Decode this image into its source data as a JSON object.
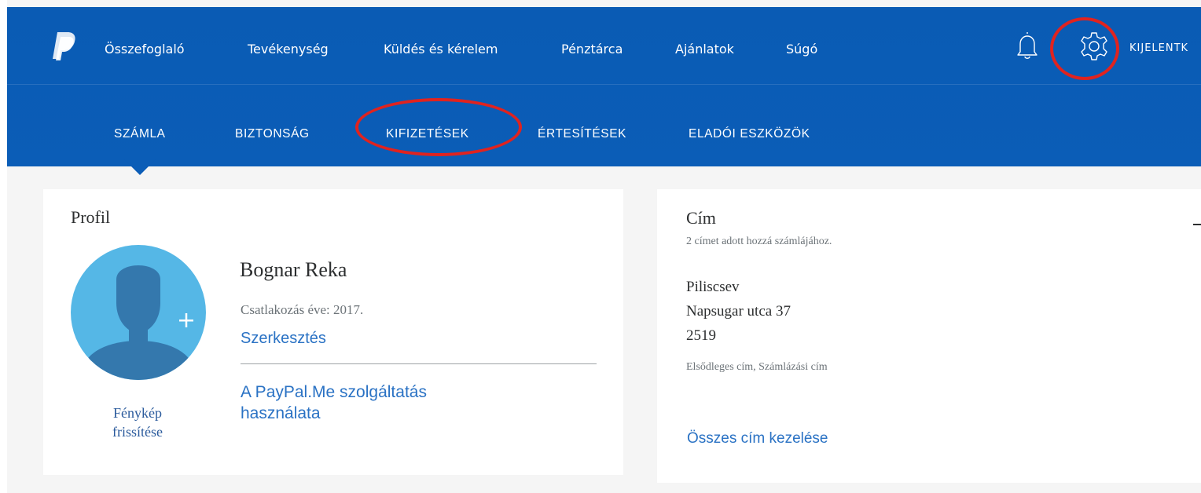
{
  "header": {
    "brand_color": "#0b5db7",
    "annotation_color": "#e0231f",
    "nav": [
      {
        "label": "Összefoglaló"
      },
      {
        "label": "Tevékenység"
      },
      {
        "label": "Küldés és kérelem"
      },
      {
        "label": "Pénztárca"
      },
      {
        "label": "Ajánlatok"
      },
      {
        "label": "Súgó"
      }
    ],
    "logout_label": "KIJELENTK",
    "subnav": [
      {
        "label": "SZÁMLA",
        "active": true
      },
      {
        "label": "BIZTONSÁG"
      },
      {
        "label": "KIFIZETÉSEK"
      },
      {
        "label": "ÉRTESÍTÉSEK"
      },
      {
        "label": "ELADÓI ESZKÖZÖK"
      }
    ],
    "icons": [
      "paypal-logo",
      "bell-icon",
      "gear-icon"
    ]
  },
  "profile": {
    "title": "Profil",
    "photo_link_line1": "Fénykép",
    "photo_link_line2": "frissítése",
    "name": "Bognar Reka",
    "joined": "Csatlakozás éve: 2017.",
    "edit_link": "Szerkesztés",
    "paypalme_line1": "A PayPal.Me szolgáltatás",
    "paypalme_line2": "használata"
  },
  "address": {
    "title": "Cím",
    "subtitle": "2 címet adott hozzá számlájához.",
    "lines": [
      "Piliscsev",
      "Napsugar utca 37",
      "2519"
    ],
    "type": "Elsődleges cím, Számlázási cím",
    "manage_link": "Összes cím kezelése"
  }
}
